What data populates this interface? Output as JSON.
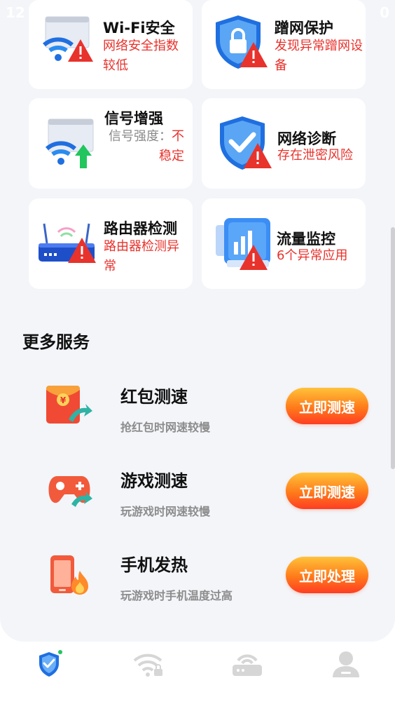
{
  "status_bar": {
    "time": "12",
    "right": "0"
  },
  "cards": [
    {
      "title": "Wi-Fi安全",
      "desc": "网络安全指数较低",
      "icon": "wifi-warning-icon"
    },
    {
      "title": "蹭网保护",
      "desc": "发现异常蹭网设备",
      "icon": "shield-lock-warning-icon"
    },
    {
      "title": "信号增强",
      "desc_label": "信号强度：",
      "desc_value": "不稳定",
      "icon": "wifi-boost-icon"
    },
    {
      "title": "网络诊断",
      "desc": "存在泄密风险",
      "icon": "shield-check-warning-icon"
    },
    {
      "title": "路由器检测",
      "desc": "路由器检测异常",
      "icon": "router-warning-icon"
    },
    {
      "title": "流量监控",
      "desc": "6个异常应用",
      "icon": "chart-warning-icon"
    }
  ],
  "more_services": {
    "title": "更多服务",
    "items": [
      {
        "title": "红包测速",
        "subtitle": "抢红包时网速较慢",
        "button": "立即测速",
        "icon": "red-packet-icon"
      },
      {
        "title": "游戏测速",
        "subtitle": "玩游戏时网速较慢",
        "button": "立即测速",
        "icon": "gamepad-icon"
      },
      {
        "title": "手机发热",
        "subtitle": "玩游戏时手机温度过高",
        "button": "立即处理",
        "icon": "phone-heat-icon"
      }
    ]
  },
  "tabs": [
    {
      "icon": "shield-check-icon",
      "active": true
    },
    {
      "icon": "wifi-lock-icon",
      "active": false
    },
    {
      "icon": "router-icon",
      "active": false
    },
    {
      "icon": "user-icon",
      "active": false
    }
  ],
  "colors": {
    "warning": "#e8322c",
    "accent": "#1f6fe0",
    "button": "#ff6a1f",
    "tab_inactive": "#d6d6d6"
  }
}
